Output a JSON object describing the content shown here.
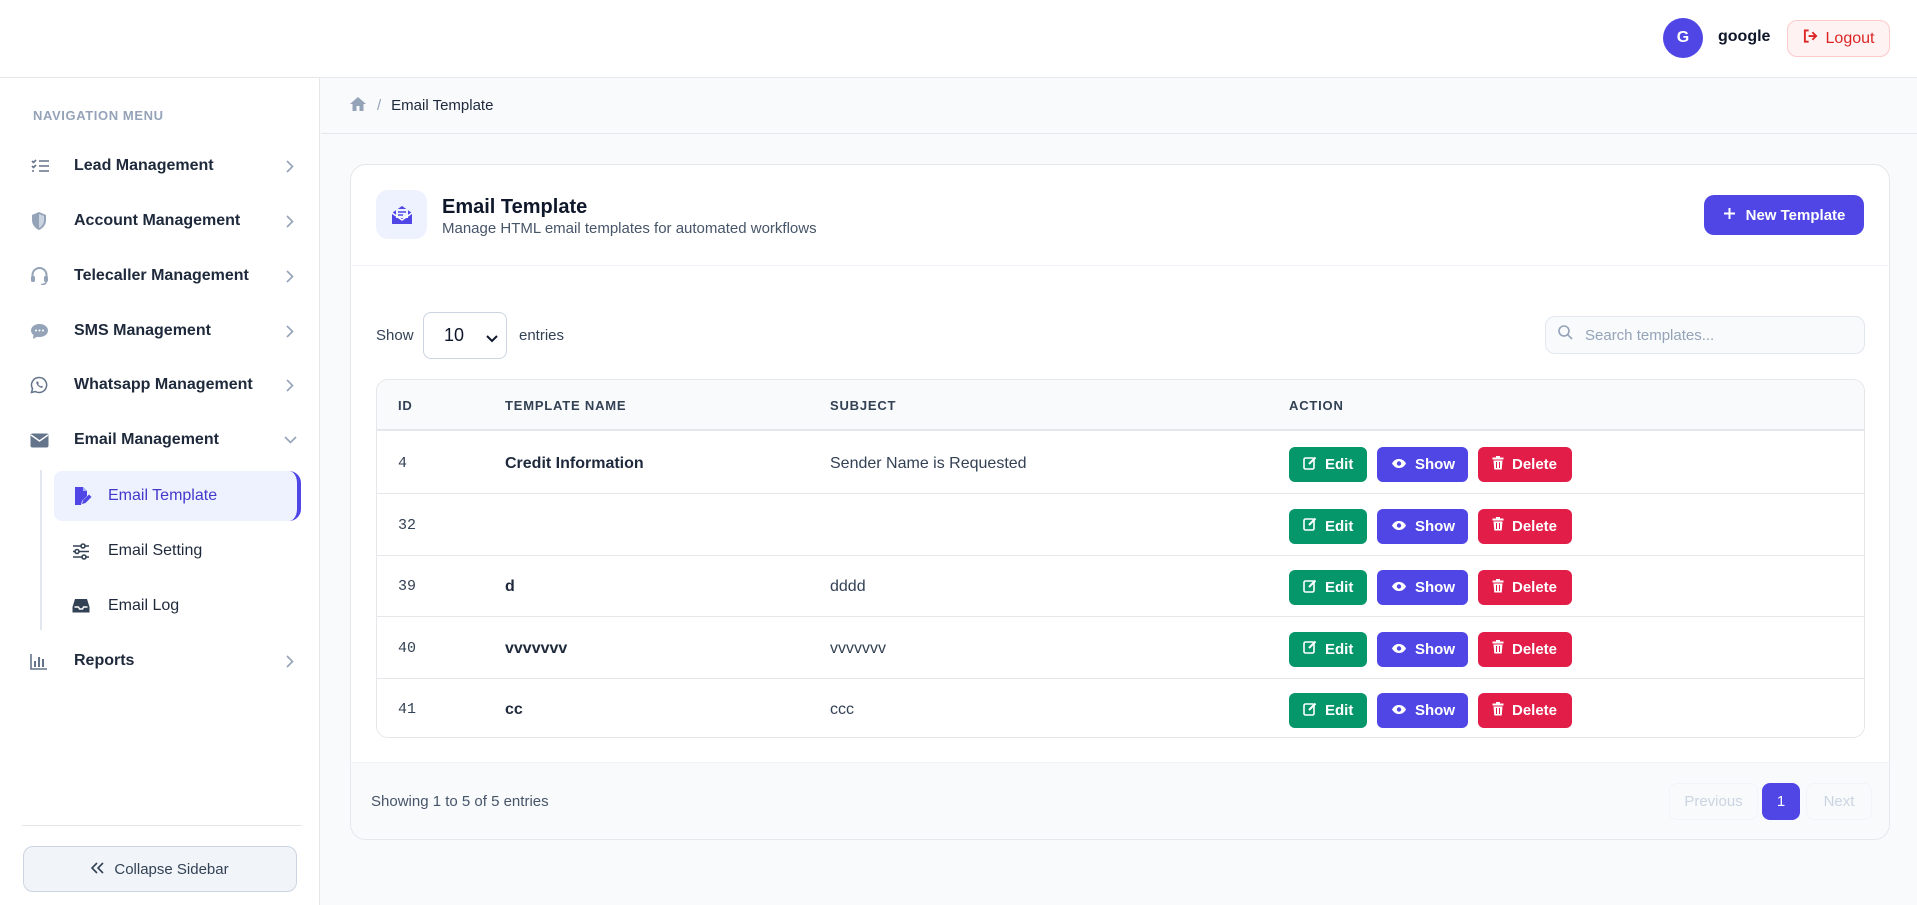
{
  "header": {
    "avatar_initial": "G",
    "user_name": "google",
    "logout_label": "Logout"
  },
  "sidebar": {
    "heading": "NAVIGATION MENU",
    "items": [
      {
        "label": "Lead Management",
        "icon": "list-check-icon"
      },
      {
        "label": "Account Management",
        "icon": "shield-icon"
      },
      {
        "label": "Telecaller Management",
        "icon": "headset-icon"
      },
      {
        "label": "SMS Management",
        "icon": "chat-icon"
      },
      {
        "label": "Whatsapp Management",
        "icon": "whatsapp-icon"
      },
      {
        "label": "Email Management",
        "icon": "envelope-icon",
        "expanded": true
      },
      {
        "label": "Reports",
        "icon": "chart-icon"
      }
    ],
    "sub_items": [
      {
        "label": "Email Template",
        "icon": "pen-file-icon",
        "active": true
      },
      {
        "label": "Email Setting",
        "icon": "sliders-icon"
      },
      {
        "label": "Email Log",
        "icon": "inbox-icon"
      }
    ],
    "collapse_label": "Collapse Sidebar"
  },
  "breadcrumb": {
    "separator": "/",
    "current": "Email Template"
  },
  "card": {
    "title": "Email Template",
    "subtitle": "Manage HTML email templates for automated workflows",
    "new_button": "New Template"
  },
  "controls": {
    "show_label": "Show",
    "entries_value": "10",
    "entries_label": "entries",
    "search_placeholder": "Search templates..."
  },
  "table": {
    "columns": [
      "ID",
      "TEMPLATE NAME",
      "SUBJECT",
      "ACTION"
    ],
    "rows": [
      {
        "id": "4",
        "name": "Credit Information",
        "subject": "Sender Name is Requested"
      },
      {
        "id": "32",
        "name": "",
        "subject": ""
      },
      {
        "id": "39",
        "name": "d",
        "subject": "dddd"
      },
      {
        "id": "40",
        "name": "vvvvvvv",
        "subject": "vvvvvvv"
      },
      {
        "id": "41",
        "name": "cc",
        "subject": "ccc"
      }
    ],
    "action_labels": {
      "edit": "Edit",
      "show": "Show",
      "delete": "Delete"
    }
  },
  "footer": {
    "info": "Showing 1 to 5 of 5 entries",
    "previous": "Previous",
    "page": "1",
    "next": "Next"
  },
  "colors": {
    "accent": "#4f46e5",
    "edit": "#059669",
    "delete": "#e11d48"
  }
}
